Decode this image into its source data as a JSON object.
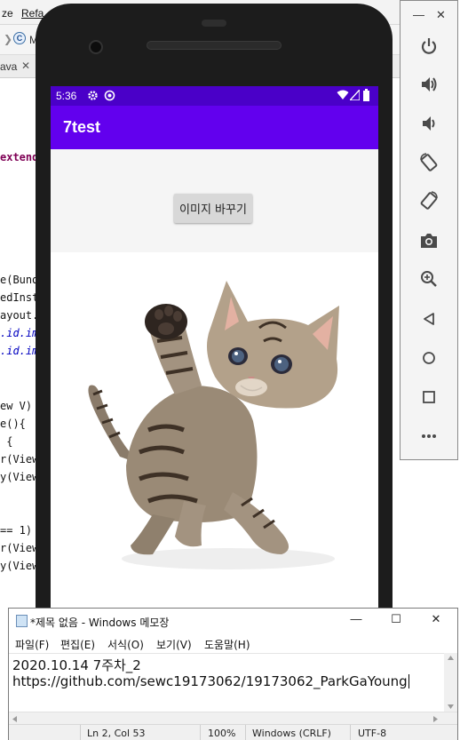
{
  "ide": {
    "menu_partial_1": "ze",
    "menu_partial_2": "Refa",
    "toolbar_partial": "M",
    "tab_partial": "ava",
    "code_lines": [
      {
        "text": "extends"
      },
      {
        "text": "e(Bundl"
      },
      {
        "text": "edInsta"
      },
      {
        "text": "ayout.a"
      },
      {
        "text": ".id.ima"
      },
      {
        "text": ".id.im"
      },
      {
        "text": "ew V)"
      },
      {
        "text": "e(){"
      },
      {
        "text": " {"
      },
      {
        "text": "r(View"
      },
      {
        "text": "y(View"
      },
      {
        "text": "== 1)"
      },
      {
        "text": "r(View"
      },
      {
        "text": "y(View"
      }
    ]
  },
  "emulator": {
    "status_time": "5:36",
    "app_title": "7test",
    "change_button_label": "이미지 바꾸기",
    "panel": {
      "minimize_label": "—",
      "close_label": "✕",
      "buttons": [
        "power-icon",
        "volume-up-icon",
        "volume-down-icon",
        "rotate-left-icon",
        "rotate-right-icon",
        "camera-icon",
        "zoom-icon",
        "back-icon",
        "home-icon",
        "overview-icon",
        "more-icon"
      ]
    },
    "accent_color": "#6200ee",
    "statusbar_color": "#4a00c8"
  },
  "notepad": {
    "title": "*제목 없음 - Windows 메모장",
    "menu": [
      "파일(F)",
      "편집(E)",
      "서식(O)",
      "보기(V)",
      "도움말(H)"
    ],
    "lines": [
      "2020.10.14 7주차_2",
      "https://github.com/sewc19173062/19173062_ParkGaYoung"
    ],
    "status": {
      "position": "Ln 2, Col 53",
      "zoom": "100%",
      "line_ending": "Windows (CRLF)",
      "encoding": "UTF-8"
    },
    "min_label": "—",
    "max_label": "☐",
    "close_label": "✕"
  }
}
